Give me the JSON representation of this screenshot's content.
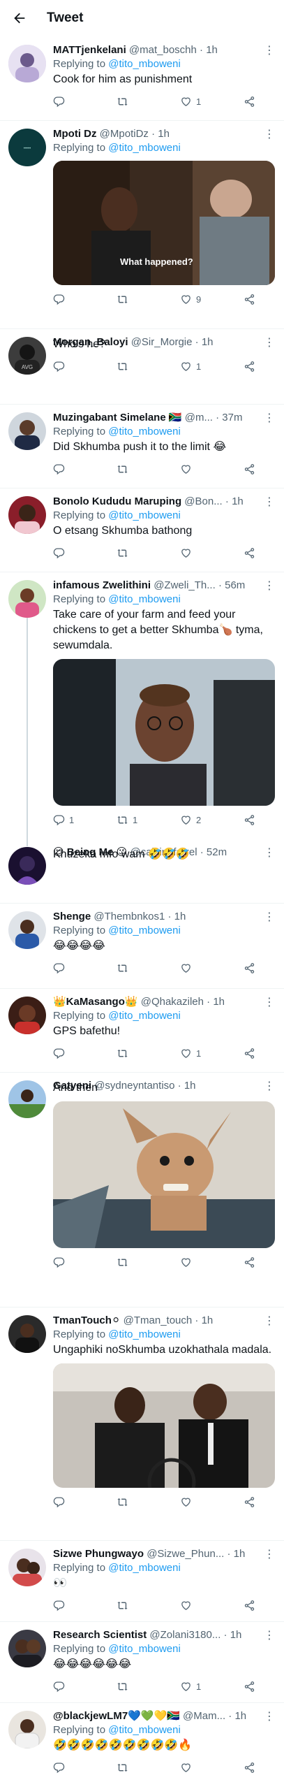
{
  "header": {
    "title": "Tweet",
    "back_icon": "arrow-left-icon"
  },
  "colors": {
    "link": "#1d9bf0",
    "muted": "#536471",
    "text": "#0f1419"
  },
  "tweets": [
    {
      "name": "MATTjenkelani",
      "handle": "@mat_boschh",
      "time": "1h",
      "replying": "Replying to",
      "mention": "@tito_mboweni",
      "text": "Cook for him as punishment",
      "replies": "",
      "retweets": "",
      "likes": "1",
      "media_caption": ""
    },
    {
      "name": "Mpoti Dz",
      "handle": "@MpotiDz",
      "time": "1h",
      "replying": "Replying to",
      "mention": "@tito_mboweni",
      "text": "",
      "replies": "",
      "retweets": "",
      "likes": "9",
      "media_caption": "What happened?"
    },
    {
      "name": "Morgan_Baloyi",
      "handle": "@Sir_Morgie",
      "time": "1h",
      "replying": "",
      "mention": "",
      "text": "Who's he?",
      "replies": "",
      "retweets": "",
      "likes": "1",
      "media_caption": ""
    },
    {
      "name": "Muzingabant Simelane 🇿🇦",
      "handle": "@m...",
      "time": "37m",
      "replying": "Replying to",
      "mention": "@tito_mboweni",
      "text": "Did Skhumba push it to the limit 😂",
      "replies": "",
      "retweets": "",
      "likes": "",
      "media_caption": ""
    },
    {
      "name": "Bonolo Kududu Maruping",
      "handle": "@Bon...",
      "time": "1h",
      "replying": "Replying to",
      "mention": "@tito_mboweni",
      "text": "O etsang Skhumba bathong",
      "replies": "",
      "retweets": "",
      "likes": "",
      "media_caption": ""
    },
    {
      "name": "infamous Zwelithini",
      "handle": "@Zweli_Th...",
      "time": "56m",
      "replying": "Replying to",
      "mention": "@tito_mboweni",
      "text": "Take care of your farm and feed your chickens to get a better Skhumba🍗 tyma, sewumdala.",
      "replies": "1",
      "retweets": "1",
      "likes": "2",
      "media_caption": ""
    },
    {
      "name": "😉 Being Me 😉",
      "handle": "@calvin_farrel",
      "time": "52m",
      "replying": "",
      "mention": "",
      "text": "Khuzeka mfo wam 🤣🤣🤣",
      "replies": "",
      "retweets": "",
      "likes": "",
      "media_caption": ""
    },
    {
      "name": "Shenge",
      "handle": "@Thembnkos1",
      "time": "1h",
      "replying": "Replying to",
      "mention": "@tito_mboweni",
      "text": "😂😂😂😂",
      "replies": "",
      "retweets": "",
      "likes": "",
      "media_caption": ""
    },
    {
      "name": "👑KaMasango👑",
      "handle": "@Qhakazileh",
      "time": "1h",
      "replying": "Replying to",
      "mention": "@tito_mboweni",
      "text": "GPS bafethu!",
      "replies": "",
      "retweets": "",
      "likes": "1",
      "media_caption": ""
    },
    {
      "name": "Gatyeni",
      "handle": "@sydneyntantiso",
      "time": "1h",
      "replying": "",
      "mention": "",
      "text": "And then",
      "replies": "",
      "retweets": "",
      "likes": "",
      "media_caption": ""
    },
    {
      "name": "TmanTouch⚪",
      "handle": "@Tman_touch",
      "time": "1h",
      "replying": "Replying to",
      "mention": "@tito_mboweni",
      "text": "Ungaphiki noSkhumba uzokhathala madala.",
      "replies": "",
      "retweets": "",
      "likes": "",
      "media_caption": ""
    },
    {
      "name": "Sizwe Phungwayo",
      "handle": "@Sizwe_Phun...",
      "time": "1h",
      "replying": "Replying to",
      "mention": "@tito_mboweni",
      "text": "👀",
      "replies": "",
      "retweets": "",
      "likes": "",
      "media_caption": ""
    },
    {
      "name": "Research Scientist",
      "handle": "@Zolani3180...",
      "time": "1h",
      "replying": "Replying to",
      "mention": "@tito_mboweni",
      "text": "😂😂😂😂😂😂",
      "replies": "",
      "retweets": "",
      "likes": "1",
      "media_caption": ""
    },
    {
      "name": "@blackjewLM7💙💚💛🇿🇦",
      "handle": "@Mam...",
      "time": "1h",
      "replying": "Replying to",
      "mention": "@tito_mboweni",
      "text": "🤣🤣🤣🤣🤣🤣🤣🤣🤣🔥",
      "replies": "",
      "retweets": "",
      "likes": "",
      "media_caption": ""
    }
  ]
}
